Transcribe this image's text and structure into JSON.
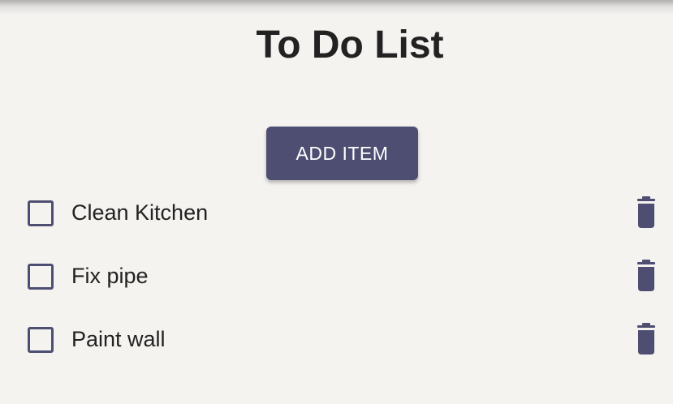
{
  "page": {
    "title": "To Do List"
  },
  "actions": {
    "add_label": "ADD ITEM"
  },
  "items": [
    {
      "label": "Clean Kitchen",
      "checked": false
    },
    {
      "label": "Fix pipe",
      "checked": false
    },
    {
      "label": "Paint wall",
      "checked": false
    }
  ],
  "icons": {
    "checkbox": "checkbox-unchecked-icon",
    "delete": "trash-icon"
  },
  "colors": {
    "background": "#f5f3f0",
    "accent": "#4e4e72",
    "text": "#222222",
    "button_text": "#ffffff"
  }
}
